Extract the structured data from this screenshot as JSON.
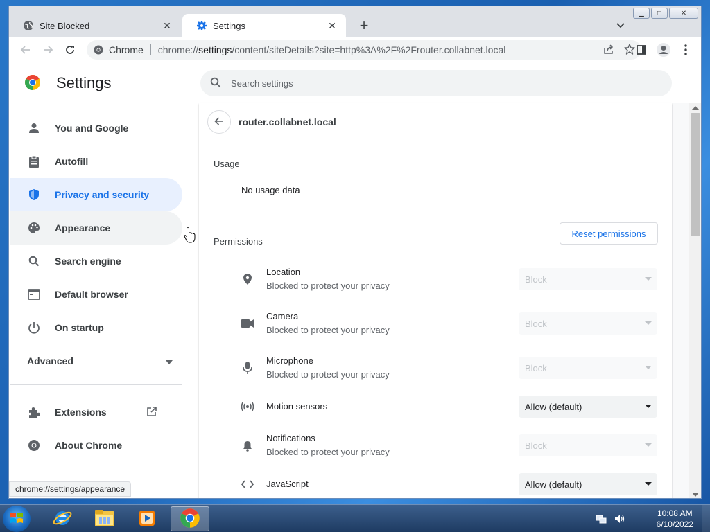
{
  "browser": {
    "tabs": [
      {
        "title": "Site Blocked",
        "active": false,
        "icon": "globe-icon"
      },
      {
        "title": "Settings",
        "active": true,
        "icon": "gear-icon"
      }
    ],
    "omnibox": {
      "chip_label": "Chrome",
      "url_prefix": "chrome://",
      "url_host": "settings",
      "url_rest": "/content/siteDetails?site=http%3A%2F%2Frouter.collabnet.local"
    }
  },
  "settings": {
    "title": "Settings",
    "search_placeholder": "Search settings",
    "nav": [
      {
        "label": "You and Google",
        "icon": "person-icon",
        "state": "normal"
      },
      {
        "label": "Autofill",
        "icon": "clipboard-icon",
        "state": "normal"
      },
      {
        "label": "Privacy and security",
        "icon": "shield-icon",
        "state": "selected"
      },
      {
        "label": "Appearance",
        "icon": "palette-icon",
        "state": "hover"
      },
      {
        "label": "Search engine",
        "icon": "search-icon",
        "state": "normal"
      },
      {
        "label": "Default browser",
        "icon": "browser-window-icon",
        "state": "normal"
      },
      {
        "label": "On startup",
        "icon": "power-icon",
        "state": "normal"
      }
    ],
    "advanced_label": "Advanced",
    "extensions_label": "Extensions",
    "about_label": "About Chrome",
    "site": {
      "name": "router.collabnet.local",
      "usage_title": "Usage",
      "usage_text": "No usage data",
      "permissions_title": "Permissions",
      "reset_label": "Reset permissions",
      "permissions": [
        {
          "label": "Location",
          "sub": "Blocked to protect your privacy",
          "value": "Block",
          "disabled": true,
          "icon": "location-pin-icon"
        },
        {
          "label": "Camera",
          "sub": "Blocked to protect your privacy",
          "value": "Block",
          "disabled": true,
          "icon": "camera-icon"
        },
        {
          "label": "Microphone",
          "sub": "Blocked to protect your privacy",
          "value": "Block",
          "disabled": true,
          "icon": "microphone-icon"
        },
        {
          "label": "Motion sensors",
          "sub": "",
          "value": "Allow (default)",
          "disabled": false,
          "icon": "motion-sensor-icon"
        },
        {
          "label": "Notifications",
          "sub": "Blocked to protect your privacy",
          "value": "Block",
          "disabled": true,
          "icon": "bell-icon"
        },
        {
          "label": "JavaScript",
          "sub": "",
          "value": "Allow (default)",
          "disabled": false,
          "icon": "code-icon"
        }
      ]
    },
    "status_url": "chrome://settings/appearance"
  },
  "taskbar": {
    "time": "10:08 AM",
    "date": "6/10/2022"
  },
  "colors": {
    "accent": "#1a73e8",
    "selected_bg": "#e8f0fe"
  }
}
